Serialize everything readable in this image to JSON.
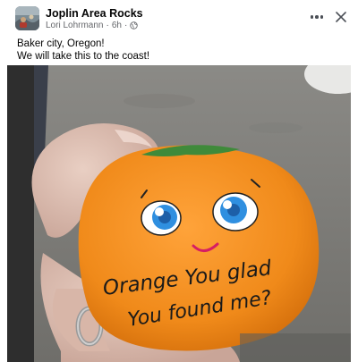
{
  "post": {
    "group_name": "Joplin Area Rocks",
    "author": "Lori Lohrmann",
    "separator": "·",
    "time": "6h",
    "privacy_icon": "globe-icon",
    "more_icon": "more-options-icon",
    "close_icon": "close-icon",
    "caption_lines": [
      "Baker city, Oregon!",
      "We will take this to the coast!"
    ]
  },
  "photo": {
    "rock_text_line1": "Orange You glad",
    "rock_text_line2": "You found me?",
    "rock_color": "#f08a1a",
    "leaf_color": "#3f8a3a",
    "eye_color": "#2f8fe0"
  },
  "colors": {
    "text_primary": "#050505",
    "text_secondary": "#65676b",
    "icon_gray": "#4b4f56"
  }
}
